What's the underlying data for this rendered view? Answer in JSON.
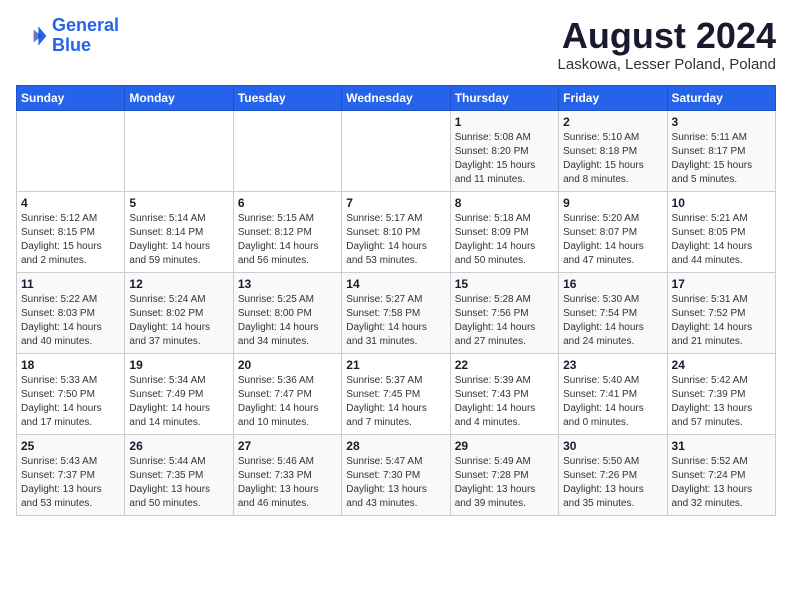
{
  "logo": {
    "line1": "General",
    "line2": "Blue"
  },
  "title": "August 2024",
  "subtitle": "Laskowa, Lesser Poland, Poland",
  "headers": [
    "Sunday",
    "Monday",
    "Tuesday",
    "Wednesday",
    "Thursday",
    "Friday",
    "Saturday"
  ],
  "weeks": [
    [
      {
        "day": "",
        "info": ""
      },
      {
        "day": "",
        "info": ""
      },
      {
        "day": "",
        "info": ""
      },
      {
        "day": "",
        "info": ""
      },
      {
        "day": "1",
        "info": "Sunrise: 5:08 AM\nSunset: 8:20 PM\nDaylight: 15 hours\nand 11 minutes."
      },
      {
        "day": "2",
        "info": "Sunrise: 5:10 AM\nSunset: 8:18 PM\nDaylight: 15 hours\nand 8 minutes."
      },
      {
        "day": "3",
        "info": "Sunrise: 5:11 AM\nSunset: 8:17 PM\nDaylight: 15 hours\nand 5 minutes."
      }
    ],
    [
      {
        "day": "4",
        "info": "Sunrise: 5:12 AM\nSunset: 8:15 PM\nDaylight: 15 hours\nand 2 minutes."
      },
      {
        "day": "5",
        "info": "Sunrise: 5:14 AM\nSunset: 8:14 PM\nDaylight: 14 hours\nand 59 minutes."
      },
      {
        "day": "6",
        "info": "Sunrise: 5:15 AM\nSunset: 8:12 PM\nDaylight: 14 hours\nand 56 minutes."
      },
      {
        "day": "7",
        "info": "Sunrise: 5:17 AM\nSunset: 8:10 PM\nDaylight: 14 hours\nand 53 minutes."
      },
      {
        "day": "8",
        "info": "Sunrise: 5:18 AM\nSunset: 8:09 PM\nDaylight: 14 hours\nand 50 minutes."
      },
      {
        "day": "9",
        "info": "Sunrise: 5:20 AM\nSunset: 8:07 PM\nDaylight: 14 hours\nand 47 minutes."
      },
      {
        "day": "10",
        "info": "Sunrise: 5:21 AM\nSunset: 8:05 PM\nDaylight: 14 hours\nand 44 minutes."
      }
    ],
    [
      {
        "day": "11",
        "info": "Sunrise: 5:22 AM\nSunset: 8:03 PM\nDaylight: 14 hours\nand 40 minutes."
      },
      {
        "day": "12",
        "info": "Sunrise: 5:24 AM\nSunset: 8:02 PM\nDaylight: 14 hours\nand 37 minutes."
      },
      {
        "day": "13",
        "info": "Sunrise: 5:25 AM\nSunset: 8:00 PM\nDaylight: 14 hours\nand 34 minutes."
      },
      {
        "day": "14",
        "info": "Sunrise: 5:27 AM\nSunset: 7:58 PM\nDaylight: 14 hours\nand 31 minutes."
      },
      {
        "day": "15",
        "info": "Sunrise: 5:28 AM\nSunset: 7:56 PM\nDaylight: 14 hours\nand 27 minutes."
      },
      {
        "day": "16",
        "info": "Sunrise: 5:30 AM\nSunset: 7:54 PM\nDaylight: 14 hours\nand 24 minutes."
      },
      {
        "day": "17",
        "info": "Sunrise: 5:31 AM\nSunset: 7:52 PM\nDaylight: 14 hours\nand 21 minutes."
      }
    ],
    [
      {
        "day": "18",
        "info": "Sunrise: 5:33 AM\nSunset: 7:50 PM\nDaylight: 14 hours\nand 17 minutes."
      },
      {
        "day": "19",
        "info": "Sunrise: 5:34 AM\nSunset: 7:49 PM\nDaylight: 14 hours\nand 14 minutes."
      },
      {
        "day": "20",
        "info": "Sunrise: 5:36 AM\nSunset: 7:47 PM\nDaylight: 14 hours\nand 10 minutes."
      },
      {
        "day": "21",
        "info": "Sunrise: 5:37 AM\nSunset: 7:45 PM\nDaylight: 14 hours\nand 7 minutes."
      },
      {
        "day": "22",
        "info": "Sunrise: 5:39 AM\nSunset: 7:43 PM\nDaylight: 14 hours\nand 4 minutes."
      },
      {
        "day": "23",
        "info": "Sunrise: 5:40 AM\nSunset: 7:41 PM\nDaylight: 14 hours\nand 0 minutes."
      },
      {
        "day": "24",
        "info": "Sunrise: 5:42 AM\nSunset: 7:39 PM\nDaylight: 13 hours\nand 57 minutes."
      }
    ],
    [
      {
        "day": "25",
        "info": "Sunrise: 5:43 AM\nSunset: 7:37 PM\nDaylight: 13 hours\nand 53 minutes."
      },
      {
        "day": "26",
        "info": "Sunrise: 5:44 AM\nSunset: 7:35 PM\nDaylight: 13 hours\nand 50 minutes."
      },
      {
        "day": "27",
        "info": "Sunrise: 5:46 AM\nSunset: 7:33 PM\nDaylight: 13 hours\nand 46 minutes."
      },
      {
        "day": "28",
        "info": "Sunrise: 5:47 AM\nSunset: 7:30 PM\nDaylight: 13 hours\nand 43 minutes."
      },
      {
        "day": "29",
        "info": "Sunrise: 5:49 AM\nSunset: 7:28 PM\nDaylight: 13 hours\nand 39 minutes."
      },
      {
        "day": "30",
        "info": "Sunrise: 5:50 AM\nSunset: 7:26 PM\nDaylight: 13 hours\nand 35 minutes."
      },
      {
        "day": "31",
        "info": "Sunrise: 5:52 AM\nSunset: 7:24 PM\nDaylight: 13 hours\nand 32 minutes."
      }
    ]
  ]
}
